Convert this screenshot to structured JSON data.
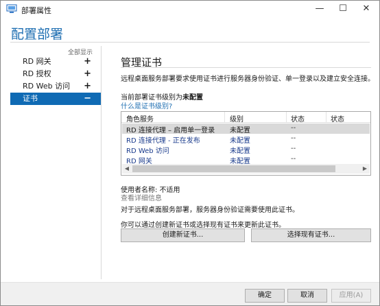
{
  "window": {
    "title": "部署属性",
    "minimize": "—",
    "maximize": "☐",
    "close": "✕"
  },
  "header": {
    "heading": "配置部署"
  },
  "sidebar": {
    "expand_all": "全部显示",
    "items": [
      {
        "label": "RD 网关",
        "sign": "+"
      },
      {
        "label": "RD 授权",
        "sign": "+"
      },
      {
        "label": "RD Web 访问",
        "sign": "+"
      },
      {
        "label": "证书",
        "sign": "−"
      }
    ]
  },
  "main": {
    "title": "管理证书",
    "description": "远程桌面服务部署要求使用证书进行服务器身份验证、单一登录以及建立安全连接。",
    "level_prefix": "当前部署证书级别为",
    "level_value": "未配置",
    "level_link": "什么是证书级别?",
    "table": {
      "headers": [
        "角色服务",
        "级别",
        "状态",
        "状态"
      ],
      "rows": [
        {
          "role": "RD 连接代理 – 启用单一登录",
          "level": "未配置",
          "status": "--"
        },
        {
          "role": "RD 连接代理 - 正在发布",
          "level": "未配置",
          "status": "--"
        },
        {
          "role": "RD Web 访问",
          "level": "未配置",
          "status": "--"
        },
        {
          "role": "RD 网关",
          "level": "未配置",
          "status": "--"
        }
      ]
    },
    "username_line": "使用者名称: 不适用",
    "details_link": "查看详细信息",
    "note_required": "对于远程桌面服务部署，服务器身份验证需要使用此证书。",
    "note_update": "你可以通过创建新证书或选择现有证书来更新此证书。",
    "create_button": "创建新证书...",
    "select_button": "选择现有证书..."
  },
  "footer": {
    "ok": "确定",
    "cancel": "取消",
    "apply": "应用(A)"
  },
  "colors": {
    "accent": "#1f6fb2",
    "selected_nav": "#0f6ab4",
    "selected_row": "#d9d9d9"
  }
}
